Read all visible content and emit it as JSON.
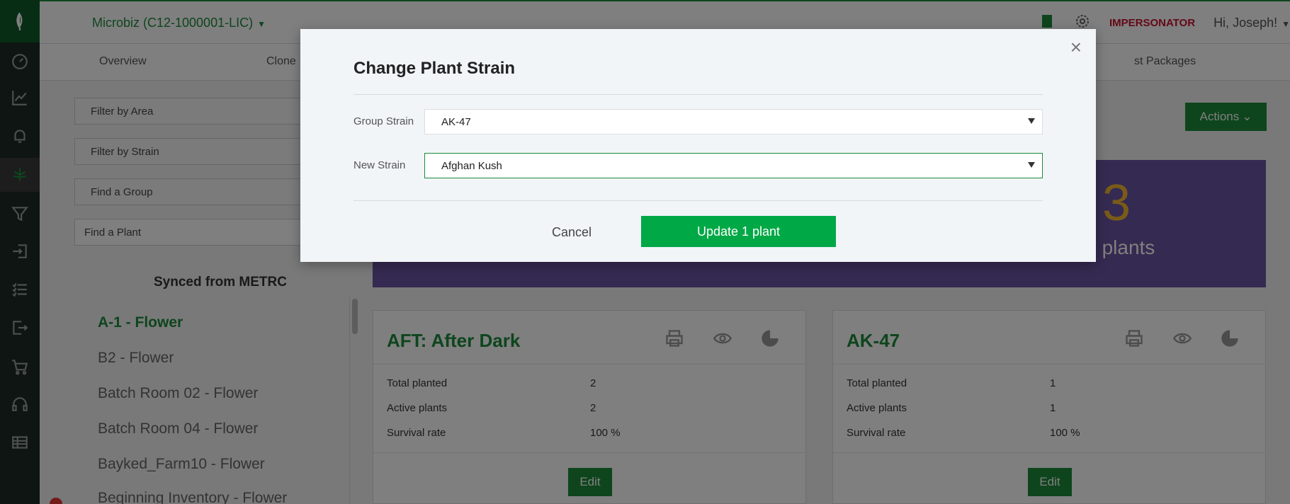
{
  "header": {
    "org_name": "Microbiz (C12-1000001-LIC)",
    "impersonator": "IMPERSONATOR",
    "greeting": "Hi, Joseph!"
  },
  "subnav": {
    "tabs": [
      "Overview",
      "Clone",
      "st Packages"
    ]
  },
  "filters": {
    "area": "Filter by Area",
    "strain": "Filter by Strain",
    "group": "Find a Group",
    "plant_placeholder": "Find a Plant"
  },
  "sidebar": {
    "synced_heading": "Synced from METRC",
    "areas": [
      "A-1 - Flower",
      "B2 - Flower",
      "Batch Room 02 - Flower",
      "Batch Room 04 - Flower",
      "Bayked_Farm10 - Flower",
      "Beginning Inventory - Flower"
    ],
    "selected_index": 0
  },
  "main": {
    "actions_label": "Actions",
    "banner_number": "3",
    "banner_label": "al plants"
  },
  "cards": [
    {
      "title": "AFT: After Dark",
      "rows": [
        {
          "label": "Total planted",
          "value": "2"
        },
        {
          "label": "Active plants",
          "value": "2"
        },
        {
          "label": "Survival rate",
          "value": "100 %"
        }
      ],
      "edit_label": "Edit"
    },
    {
      "title": "AK-47",
      "rows": [
        {
          "label": "Total planted",
          "value": "1"
        },
        {
          "label": "Active plants",
          "value": "1"
        },
        {
          "label": "Survival rate",
          "value": "100 %"
        }
      ],
      "edit_label": "Edit"
    }
  ],
  "modal": {
    "title": "Change Plant Strain",
    "close_symbol": "×",
    "group_strain_label": "Group Strain",
    "group_strain_value": "AK-47",
    "new_strain_label": "New Strain",
    "new_strain_value": "Afghan Kush",
    "cancel_label": "Cancel",
    "update_label": "Update 1 plant"
  },
  "colors": {
    "brand_green": "#1c8a3a",
    "update_green": "#00a846",
    "banner_purple": "#6a55a3",
    "impersonator_red": "#c8102e"
  },
  "icons": [
    "leaf-logo-icon",
    "dashboard-icon",
    "chart-icon",
    "bell-icon",
    "cannabis-icon",
    "filter-icon",
    "sign-in-icon",
    "checklist-icon",
    "sign-out-icon",
    "cart-icon",
    "headset-icon",
    "table-icon",
    "book-icon",
    "gear-icon",
    "print-icon",
    "eye-icon",
    "pie-chart-icon",
    "close-icon"
  ]
}
